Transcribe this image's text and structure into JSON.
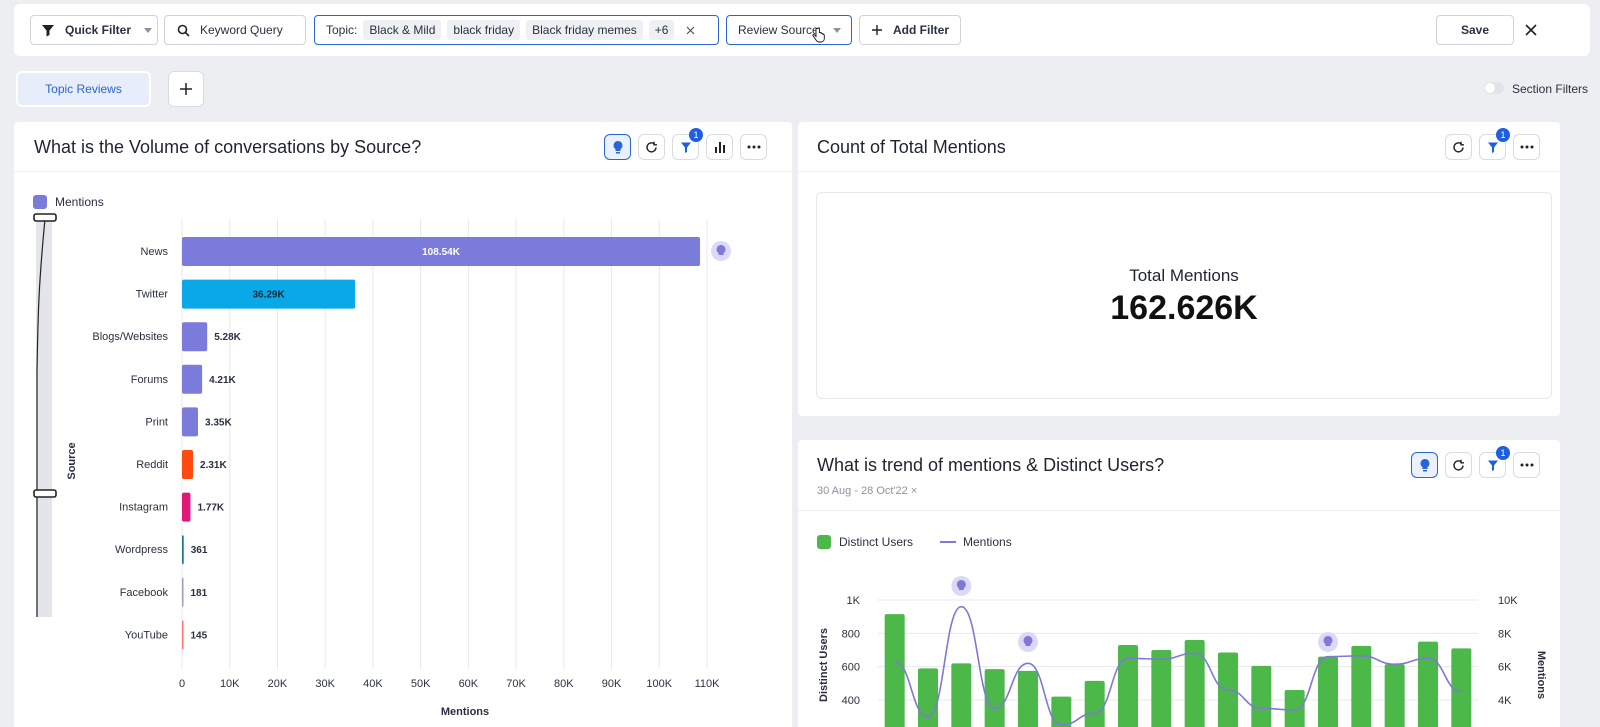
{
  "filter_bar": {
    "quick_filter": "Quick Filter",
    "keyword_query": "Keyword Query",
    "topic_label": "Topic:",
    "topic_chips": [
      "Black & Mild",
      "black friday",
      "Black friday memes"
    ],
    "topic_more": "+6",
    "review_source": "Review Source",
    "add_filter": "Add Filter",
    "save": "Save"
  },
  "tabs": {
    "active": "Topic Reviews",
    "section_filters": "Section Filters"
  },
  "panel_source": {
    "title": "What is the Volume of conversations by Source?",
    "legend": "Mentions",
    "y_axis_title": "Source",
    "x_axis_title": "Mentions",
    "filter_badge": "1"
  },
  "panel_count": {
    "title": "Count of Total Mentions",
    "metric_label": "Total Mentions",
    "metric_value": "162.626K",
    "filter_badge": "1"
  },
  "panel_trend": {
    "title": "What is trend of mentions & Distinct Users?",
    "date_range": "30 Aug - 28 Oct'22",
    "legend_bars": "Distinct Users",
    "legend_line": "Mentions",
    "left_axis_title": "Distinct Users",
    "right_axis_title": "Mentions",
    "filter_badge": "1"
  },
  "colors": {
    "accent": "#2a64d6",
    "bar_default": "#7b7bdb",
    "twitter": "#0aa8e6",
    "reddit": "#ff4a10",
    "instagram": "#e2177a",
    "wordpress": "#20739b",
    "facebook": "#9aa3b5",
    "youtube": "#ff7373",
    "users_green": "#4cb84a",
    "mentions_line": "#7f78d8"
  },
  "chart_data": [
    {
      "type": "bar",
      "orientation": "horizontal",
      "title": "What is the Volume of conversations by Source?",
      "xlabel": "Mentions",
      "ylabel": "Source",
      "xlim": [
        0,
        110000
      ],
      "x_ticks": [
        "0",
        "10K",
        "20K",
        "30K",
        "40K",
        "50K",
        "60K",
        "70K",
        "80K",
        "90K",
        "100K",
        "110K"
      ],
      "categories": [
        "News",
        "Twitter",
        "Blogs/Websites",
        "Forums",
        "Print",
        "Reddit",
        "Instagram",
        "Wordpress",
        "Facebook",
        "YouTube"
      ],
      "values": [
        108540,
        36290,
        5280,
        4210,
        3350,
        2310,
        1770,
        361,
        181,
        145
      ],
      "labels": [
        "108.54K",
        "36.29K",
        "5.28K",
        "4.21K",
        "3.35K",
        "2.31K",
        "1.77K",
        "361",
        "181",
        "145"
      ],
      "series": [
        {
          "name": "Mentions"
        }
      ],
      "legend": "top-left",
      "grid": true
    },
    {
      "type": "bar",
      "title": "What is trend of mentions & Distinct Users?",
      "ylabel": "Distinct Users",
      "y2label": "Mentions",
      "y_ticks": [
        "400",
        "600",
        "800",
        "1K"
      ],
      "y2_ticks": [
        "4K",
        "6K",
        "8K",
        "10K"
      ],
      "series": [
        {
          "name": "Distinct Users",
          "type": "bar",
          "values": [
            915,
            590,
            620,
            585,
            575,
            420,
            515,
            730,
            700,
            760,
            685,
            605,
            460,
            660,
            725,
            615,
            750,
            710
          ]
        },
        {
          "name": "Mentions",
          "type": "line",
          "values": [
            6300,
            3000,
            9600,
            3500,
            6200,
            2500,
            3200,
            6500,
            6450,
            6800,
            4600,
            3500,
            3400,
            6600,
            6650,
            6150,
            6500,
            4500
          ]
        }
      ],
      "legend": "top-left",
      "grid": true
    }
  ]
}
